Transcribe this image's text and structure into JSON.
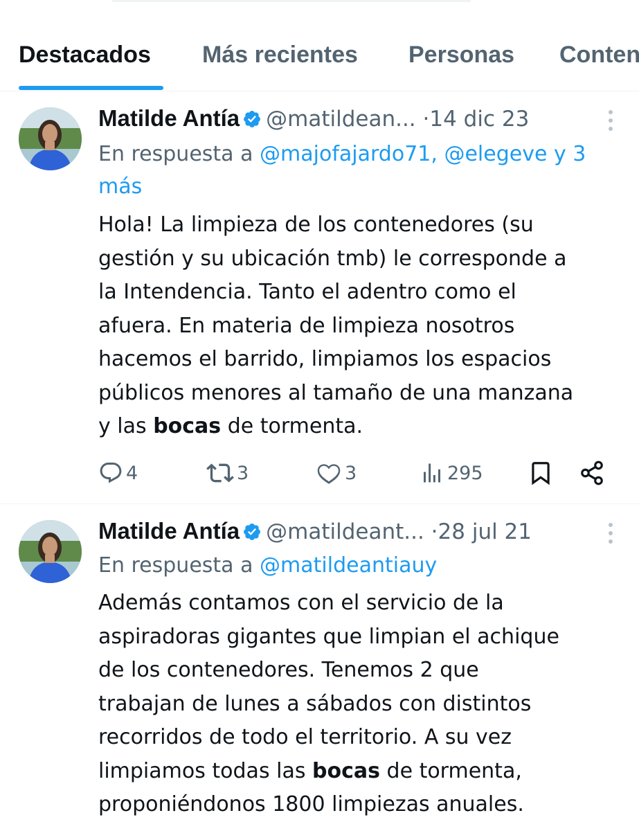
{
  "tabs": [
    {
      "label": "Destacados",
      "active": true
    },
    {
      "label": "Más recientes",
      "active": false
    },
    {
      "label": "Personas",
      "active": false
    },
    {
      "label": "Conten",
      "active": false
    }
  ],
  "tweets": [
    {
      "name": "Matilde Antía",
      "handle": "@matildean...",
      "separator": "·",
      "date": "14 dic 23",
      "reply_prefix": "En respuesta a",
      "reply_mentions": "@majofajardo71, @elegeve y 3 más",
      "body_lines": [
        "Hola! La limpieza de los contenedores (su",
        "gestión y su ubicación tmb) le corresponde a",
        "la Intendencia. Tanto el adentro como el",
        "afuera. En materia de limpieza nosotros",
        "hacemos el barrido, limpiamos los espacios",
        "públicos menores al tamaño de una manzana"
      ],
      "body_last_prefix": "y las",
      "body_highlight": "bocas",
      "body_last_suffix": "de tormenta.",
      "replies": "4",
      "reposts": "3",
      "likes": "3",
      "views": "295"
    },
    {
      "name": "Matilde Antía",
      "handle": "@matildeant...",
      "separator": "·",
      "date": "28 jul 21",
      "reply_prefix": "En respuesta a",
      "reply_mentions": "@matildeantiauy",
      "body_lines": [
        "Además contamos con el servicio de la",
        "aspiradoras gigantes que limpian el achique",
        "de los contenedores. Tenemos 2 que",
        "trabajan de lunes a sábados con distintos",
        "recorridos de todo el territorio. A su vez"
      ],
      "body_mid_prefix": "limpiamos todas las",
      "body_highlight": "bocas",
      "body_mid_suffix": "de tormenta,",
      "body_last_line": "proponiéndonos 1800 limpiezas anuales."
    }
  ],
  "colors": {
    "accent": "#1d9bf0",
    "text": "#0f1419",
    "secondary": "#536471"
  }
}
